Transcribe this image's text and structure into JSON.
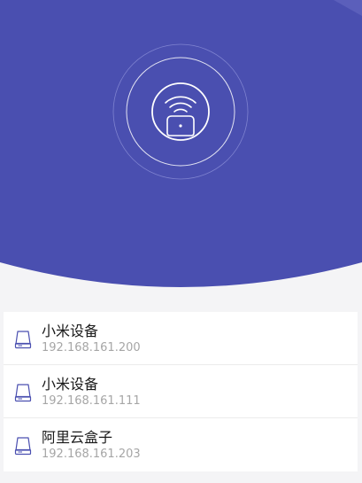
{
  "theme": {
    "header_color": "#4a4fb0",
    "background": "#f4f4f6"
  },
  "scanner": {
    "icon": "wifi-router-icon"
  },
  "devices": [
    {
      "name": "小米设备",
      "ip": "192.168.161.200",
      "icon": "hard-drive-icon"
    },
    {
      "name": "小米设备",
      "ip": "192.168.161.111",
      "icon": "hard-drive-icon"
    },
    {
      "name": "阿里云盒子",
      "ip": "192.168.161.203",
      "icon": "hard-drive-icon"
    }
  ]
}
